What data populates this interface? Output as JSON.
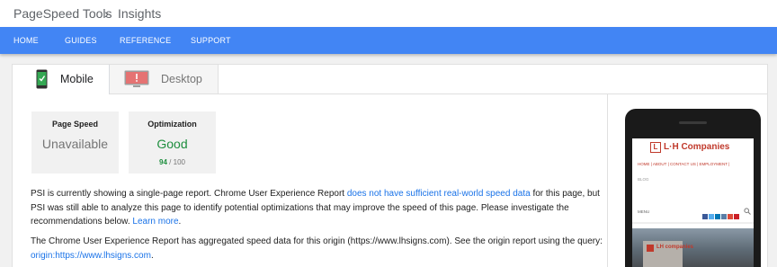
{
  "breadcrumb": {
    "root": "PageSpeed Tools",
    "separator": "›",
    "current": "Insights"
  },
  "nav": [
    "HOME",
    "GUIDES",
    "REFERENCE",
    "SUPPORT"
  ],
  "tabs": [
    {
      "label": "Mobile",
      "selected": true
    },
    {
      "label": "Desktop",
      "selected": false
    }
  ],
  "scores": {
    "page_speed": {
      "title": "Page Speed",
      "value": "Unavailable"
    },
    "optimization": {
      "title": "Optimization",
      "value": "Good",
      "score": "94",
      "max": "/ 100"
    }
  },
  "report": {
    "p1_a": "PSI is currently showing a single-page report. Chrome User Experience Report ",
    "p1_link": "does not have sufficient real-world speed data",
    "p1_b": " for this page, but PSI was still able to analyze this page to identify potential optimizations that may improve the speed of this page. Please investigate the recommendations below. ",
    "p1_learn": "Learn more",
    "p1_end": ".",
    "p2_a": "The Chrome User Experience Report has aggregated speed data for this origin (https://www.lhsigns.com). See the origin report using the query: ",
    "p2_link": "origin:https://www.lhsigns.com",
    "p2_end": "."
  },
  "preview": {
    "logo_mark": "L",
    "logo_text": "L·H Companies",
    "site_nav": "HOME | ABOUT | CONTACT US | EMPLOYMENT |",
    "blog": "BLOG",
    "menu": "MENU",
    "photo_sign": "LH companies"
  },
  "colors": {
    "nav": "#4285f4",
    "good": "#1e8e3e",
    "link": "#1a73e8",
    "logo_red": "#c0392b"
  }
}
